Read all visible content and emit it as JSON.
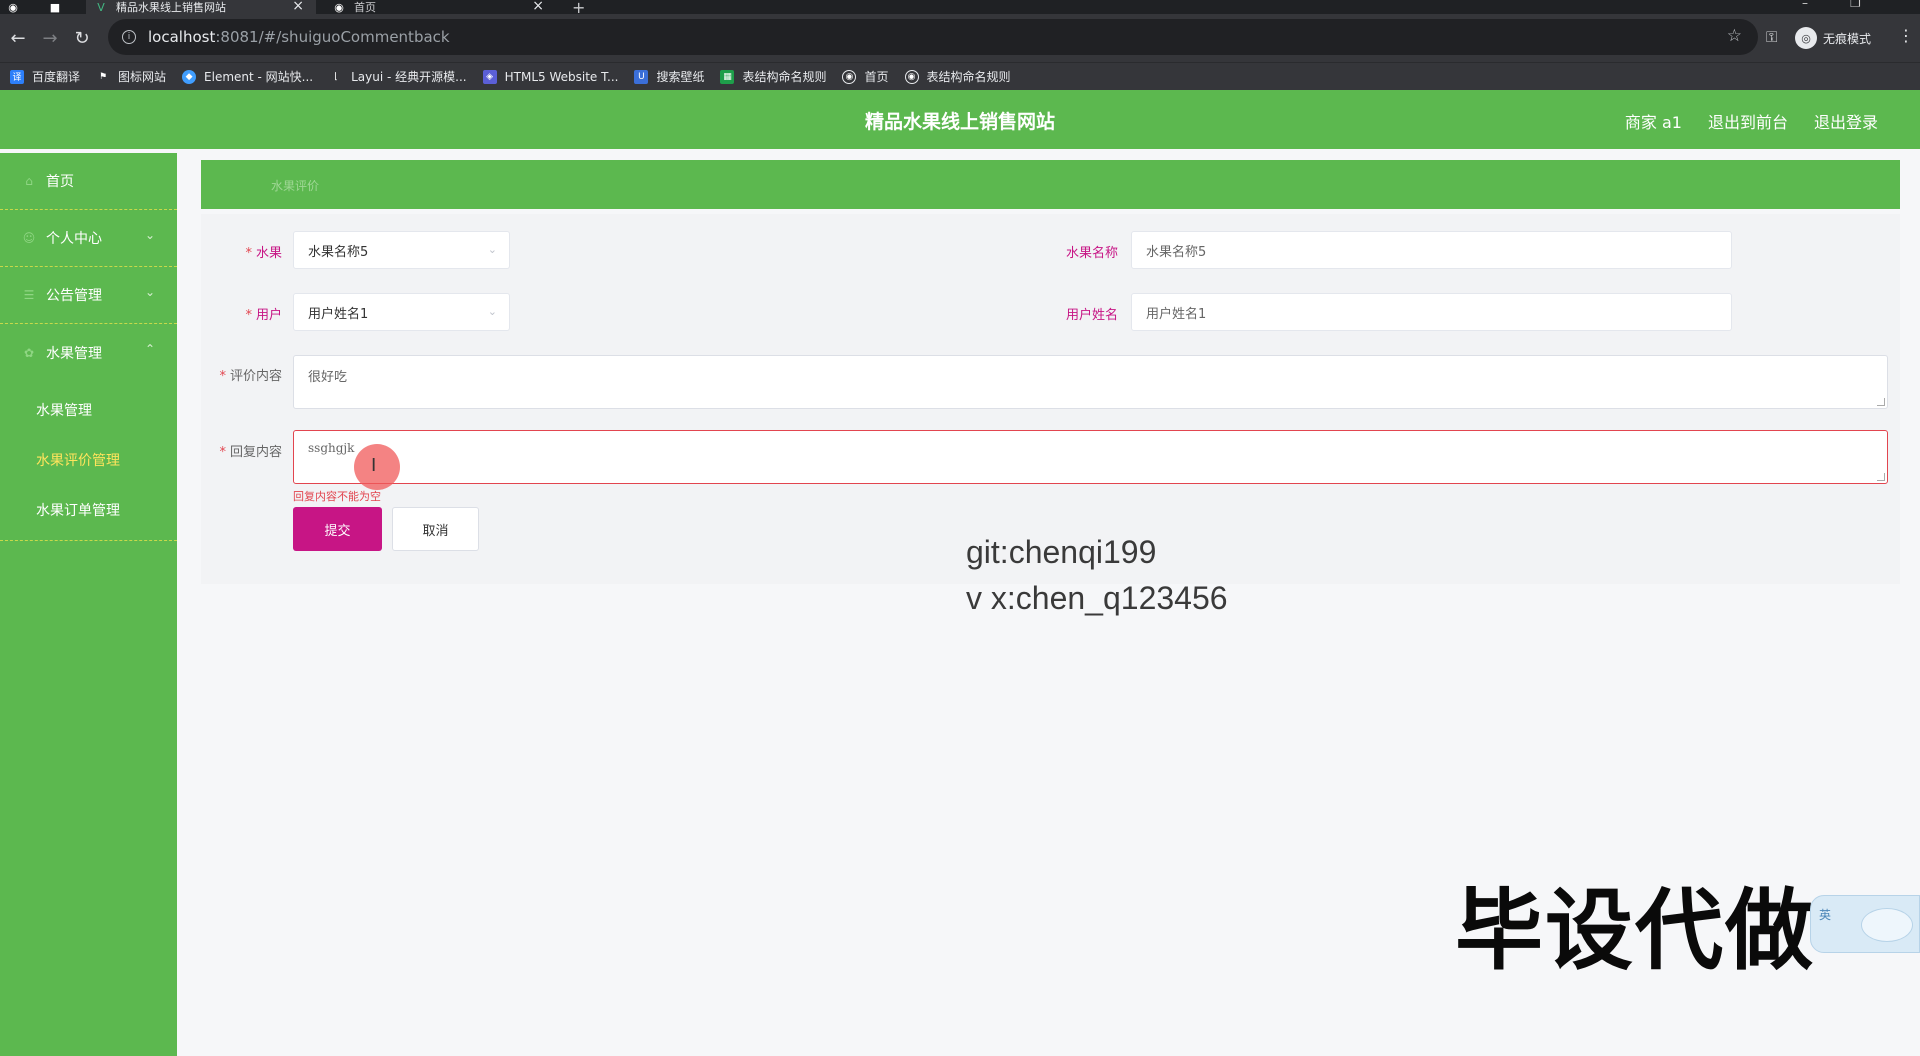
{
  "browser": {
    "tabs": [
      {
        "title": "精品水果线上销售网站",
        "active": true
      },
      {
        "title": "首页",
        "active": false
      }
    ],
    "new_tab_symbol": "+",
    "url_host": "localhost",
    "url_path": ":8081/#/shuiguoCommentback",
    "incognito_label": "无痕模式",
    "bookmarks": [
      {
        "label": "百度翻译",
        "icon": "translate-icon",
        "color": "#2d7ff9"
      },
      {
        "label": "图标网站",
        "icon": "flag-icon",
        "color": "#35363a"
      },
      {
        "label": "Element - 网站快...",
        "icon": "element-icon",
        "color": "#409eff"
      },
      {
        "label": "Layui - 经典开源模...",
        "icon": "layui-icon",
        "color": "#35363a"
      },
      {
        "label": "HTML5 Website T...",
        "icon": "html5-icon",
        "color": "#5b5fd6"
      },
      {
        "label": "搜索壁纸",
        "icon": "wallpaper-icon",
        "color": "#3b6fd8"
      },
      {
        "label": "表结构命名规则",
        "icon": "sheet-icon",
        "color": "#1e9e4a"
      },
      {
        "label": "首页",
        "icon": "globe-icon",
        "color": "#35363a"
      },
      {
        "label": "表结构命名规则",
        "icon": "globe-icon",
        "color": "#35363a"
      }
    ]
  },
  "header": {
    "title": "精品水果线上销售网站",
    "links": [
      "商家 a1",
      "退出到前台",
      "退出登录"
    ]
  },
  "sidebar": {
    "items": [
      {
        "label": "首页",
        "icon": "home-icon"
      },
      {
        "label": "个人中心",
        "icon": "user-icon",
        "chevron": "down"
      },
      {
        "label": "公告管理",
        "icon": "notice-icon",
        "chevron": "down"
      },
      {
        "label": "水果管理",
        "icon": "fruit-icon",
        "chevron": "up"
      }
    ],
    "subitems": [
      {
        "label": "水果管理",
        "active": false
      },
      {
        "label": "水果评价管理",
        "active": true
      },
      {
        "label": "水果订单管理",
        "active": false
      }
    ]
  },
  "breadcrumb": {
    "text": "水果评价"
  },
  "form": {
    "fruit_label": "水果",
    "fruit_value": "水果名称5",
    "fruit_name_label": "水果名称",
    "fruit_name_value": "水果名称5",
    "user_label": "用户",
    "user_value": "用户姓名1",
    "user_name_label": "用户姓名",
    "user_name_value": "用户姓名1",
    "comment_label": "评价内容",
    "comment_value": "很好吃",
    "reply_label": "回复内容",
    "reply_value": "ssghgjk",
    "reply_error": "回复内容不能为空",
    "required_mark": "*",
    "submit_label": "提交",
    "cancel_label": "取消"
  },
  "overlay": {
    "git_text": "git:chenqi199",
    "vx_text": "v x:chen_q123456",
    "promo_text": "毕设代做",
    "mascot_text": "英"
  },
  "colors": {
    "brand_green": "#5cb84f",
    "accent_pink": "#c71585",
    "error_red": "#e2454f",
    "active_yellow": "#ffe45c"
  }
}
